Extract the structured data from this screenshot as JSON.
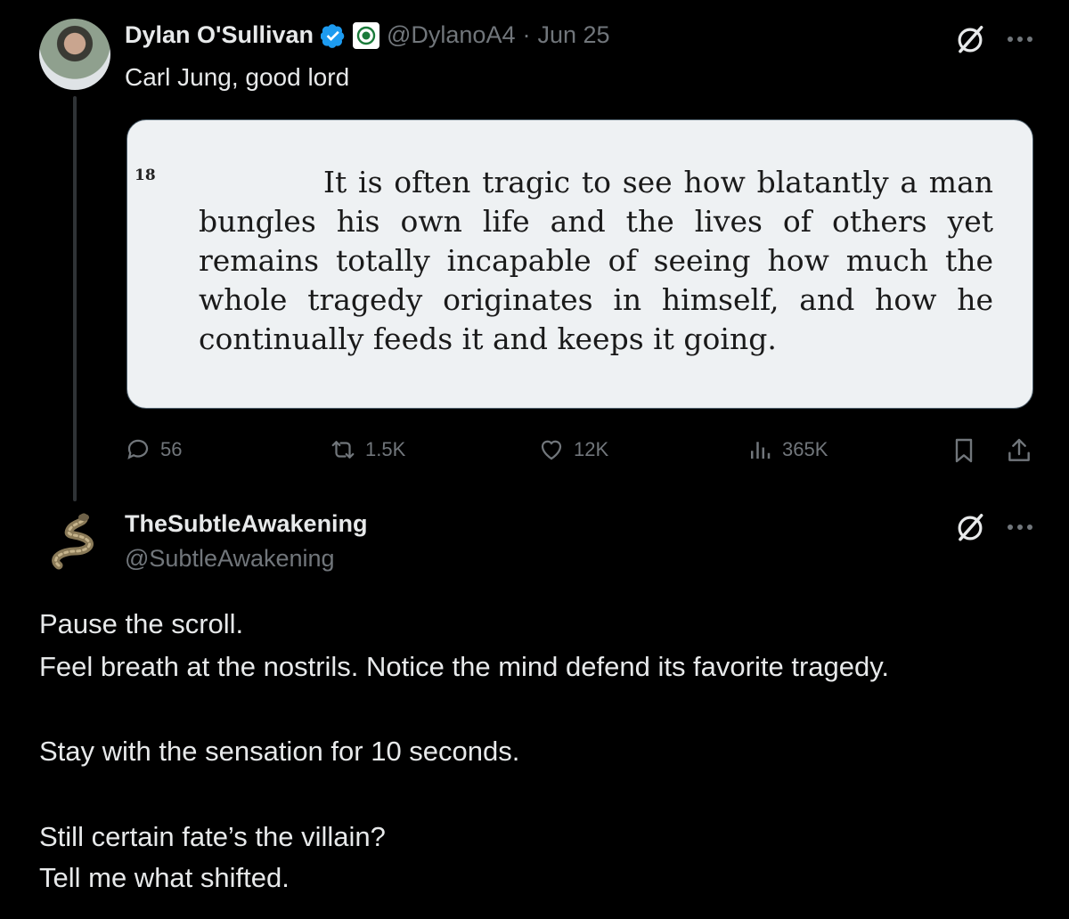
{
  "post": {
    "author_name": "Dylan O'Sullivan",
    "handle": "@DylanoA4",
    "separator": "·",
    "date": "Jun 25",
    "text": "Carl Jung, good lord",
    "quote_image": {
      "page_number": "18",
      "text": "It is often tragic to see how blatantly a man bungles his own life and the lives of others yet remains totally incapable of seeing how much the whole tragedy originates in himself, and how he continually feeds it and keeps it going."
    },
    "stats": {
      "replies": "56",
      "reposts": "1.5K",
      "likes": "12K",
      "views": "365K"
    }
  },
  "reply": {
    "author_name": "TheSubtleAwakening",
    "handle": "@SubtleAwakening",
    "lines": [
      "Pause the scroll.",
      "Feel breath at the nostrils. Notice the mind defend its favorite tragedy.",
      "Stay with the sensation for 10 seconds.",
      "Still certain fate’s the villain?",
      "Tell me what shifted."
    ]
  },
  "icons": {
    "verified": "verified-badge-icon",
    "affiliate": "affiliate-badge-icon",
    "grok": "grok-icon",
    "more": "more-icon",
    "reply": "reply-icon",
    "repost": "repost-icon",
    "like": "like-icon",
    "views": "views-icon",
    "bookmark": "bookmark-icon",
    "share": "share-icon"
  },
  "colors": {
    "background": "#000000",
    "text": "#e7e9ea",
    "muted": "#71767b",
    "verified": "#1d9bf0",
    "card": "#eef1f3"
  }
}
